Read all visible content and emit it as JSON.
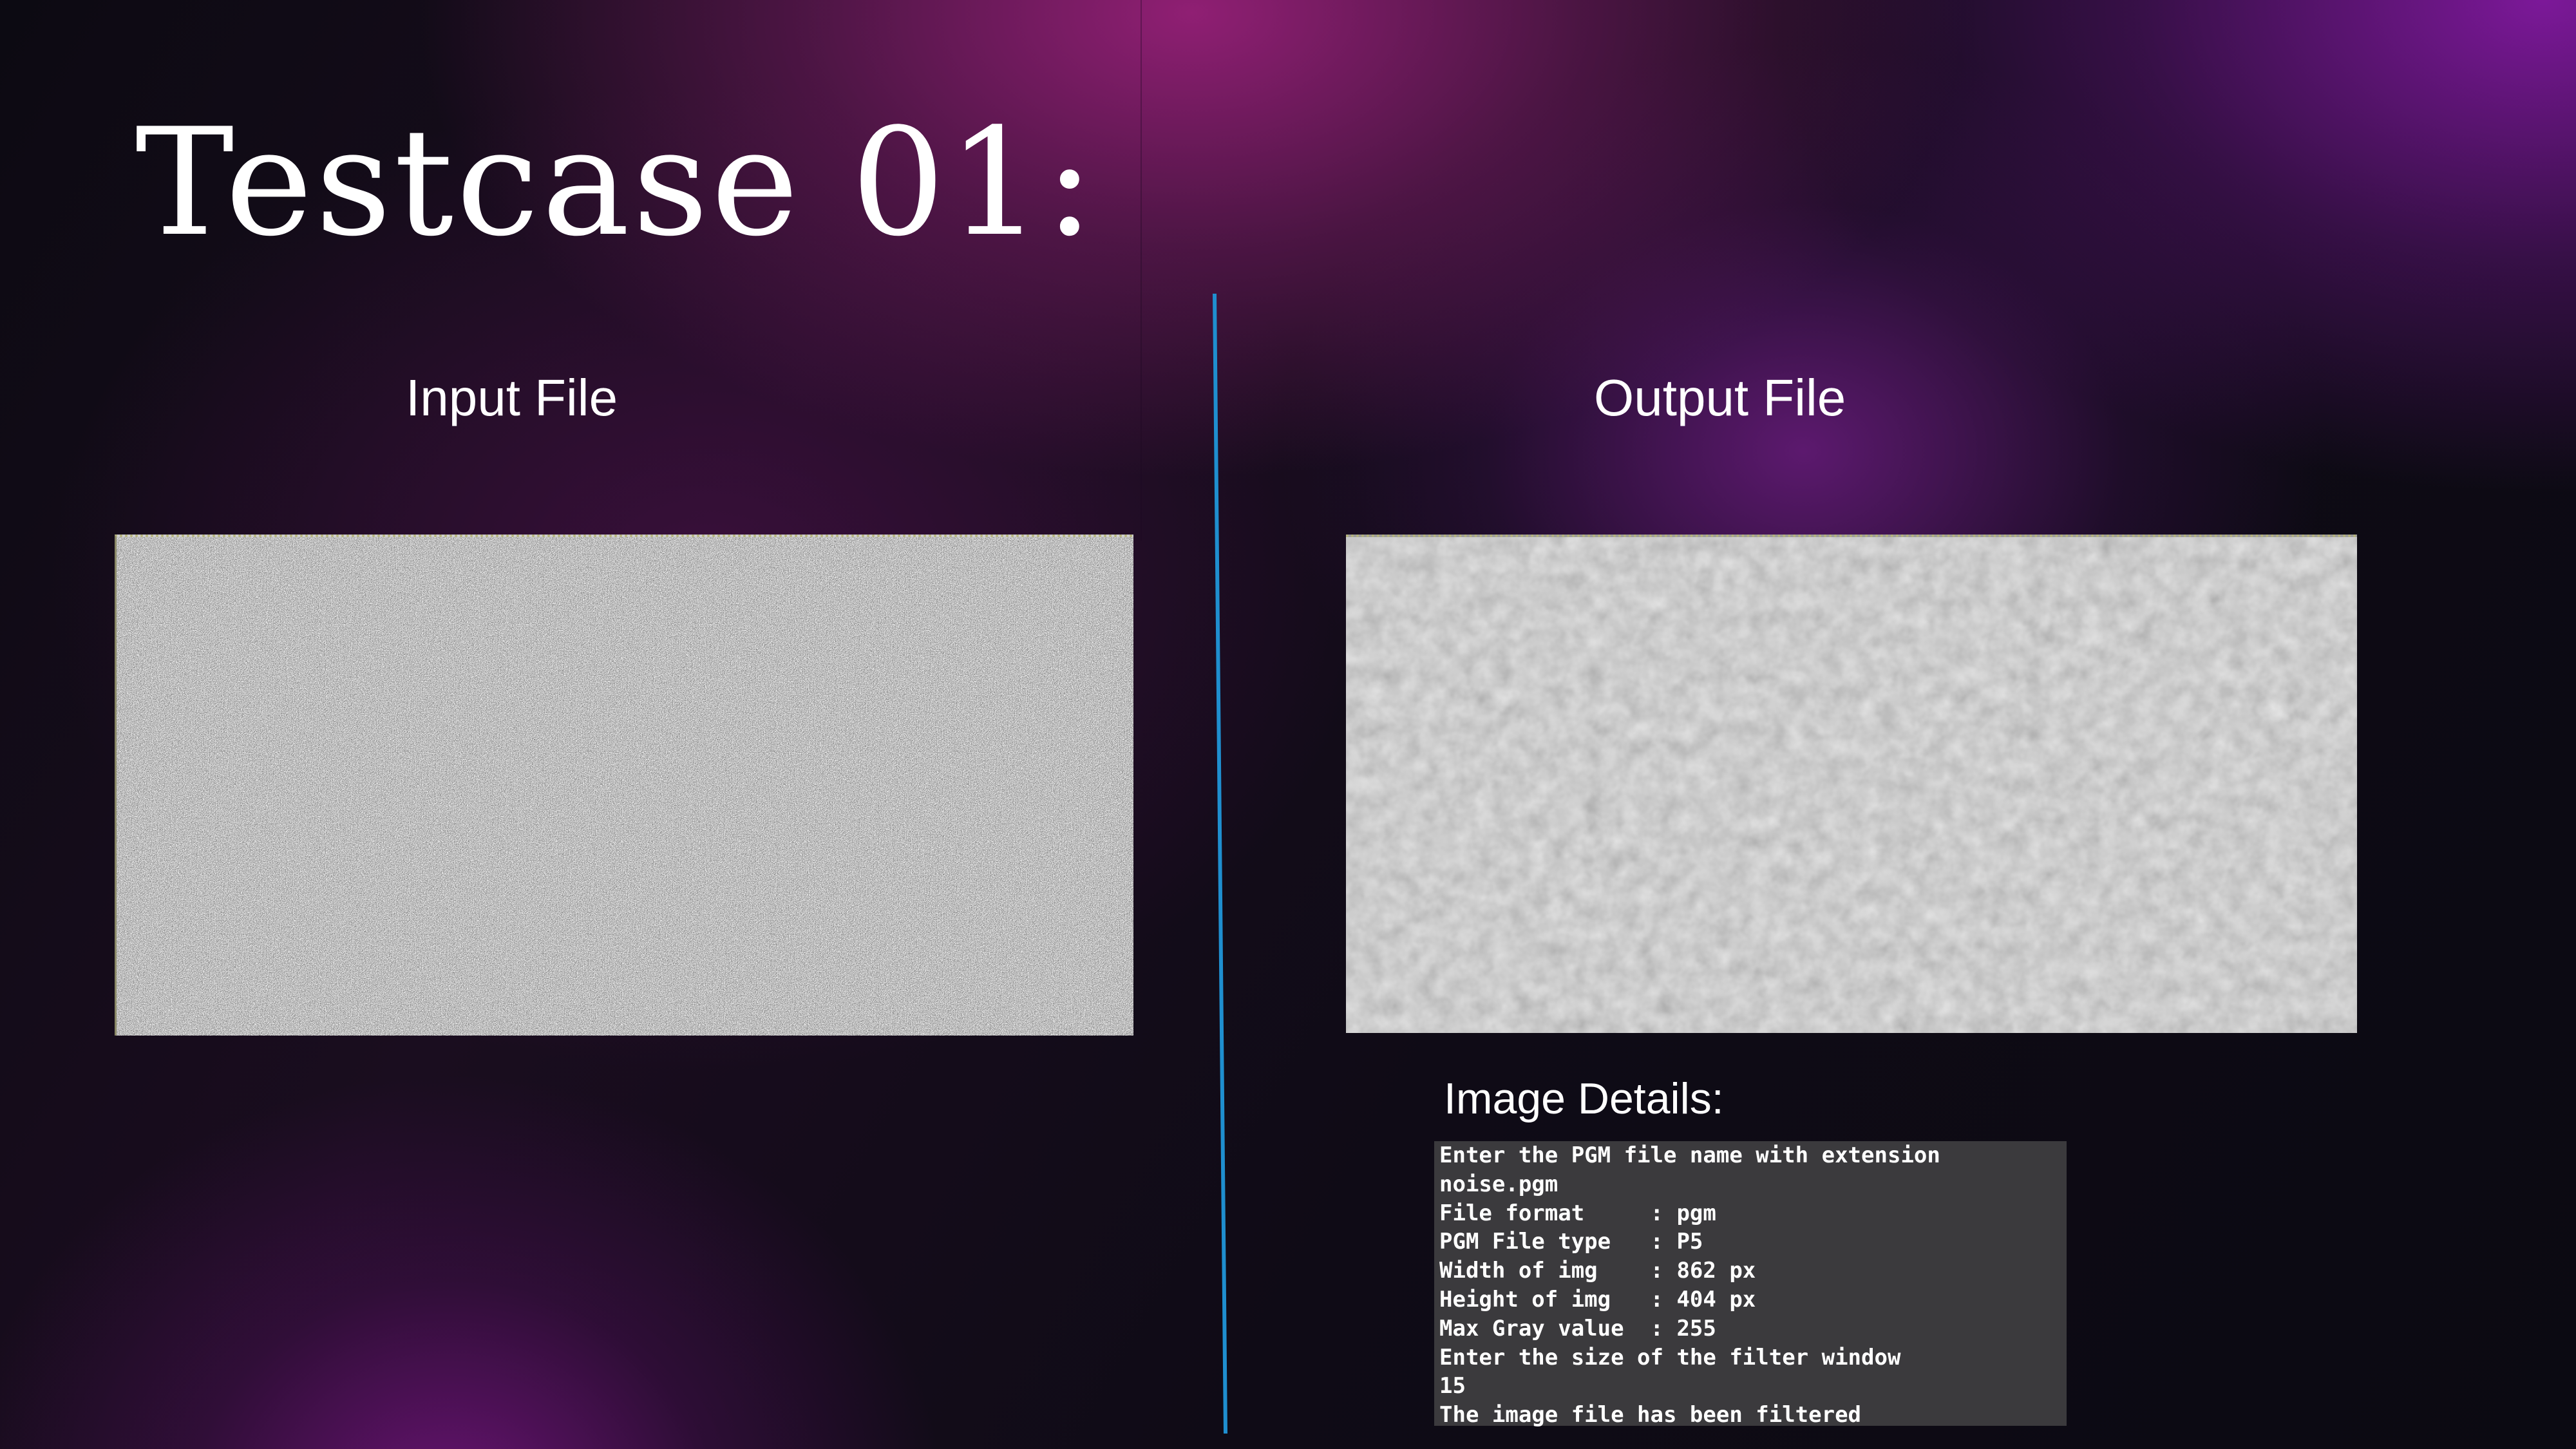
{
  "slide": {
    "title": "Testcase 01:",
    "input_heading": "Input File",
    "output_heading": "Output File",
    "details_heading": "Image Details:",
    "input_image": "noise-image",
    "output_image": "filtered-image"
  },
  "terminal": {
    "lines": [
      "Enter the PGM file name with extension",
      "noise.pgm",
      "File format     : pgm",
      "PGM File type   : P5",
      "Width of img    : 862 px",
      "Height of img   : 404 px",
      "Max Gray value  : 255",
      "Enter the size of the filter window",
      "15",
      "The image file has been filtered"
    ]
  },
  "colors": {
    "divider": "#1f8fcf",
    "terminal_bg": "#3b3a3d",
    "text": "#ffffff"
  }
}
